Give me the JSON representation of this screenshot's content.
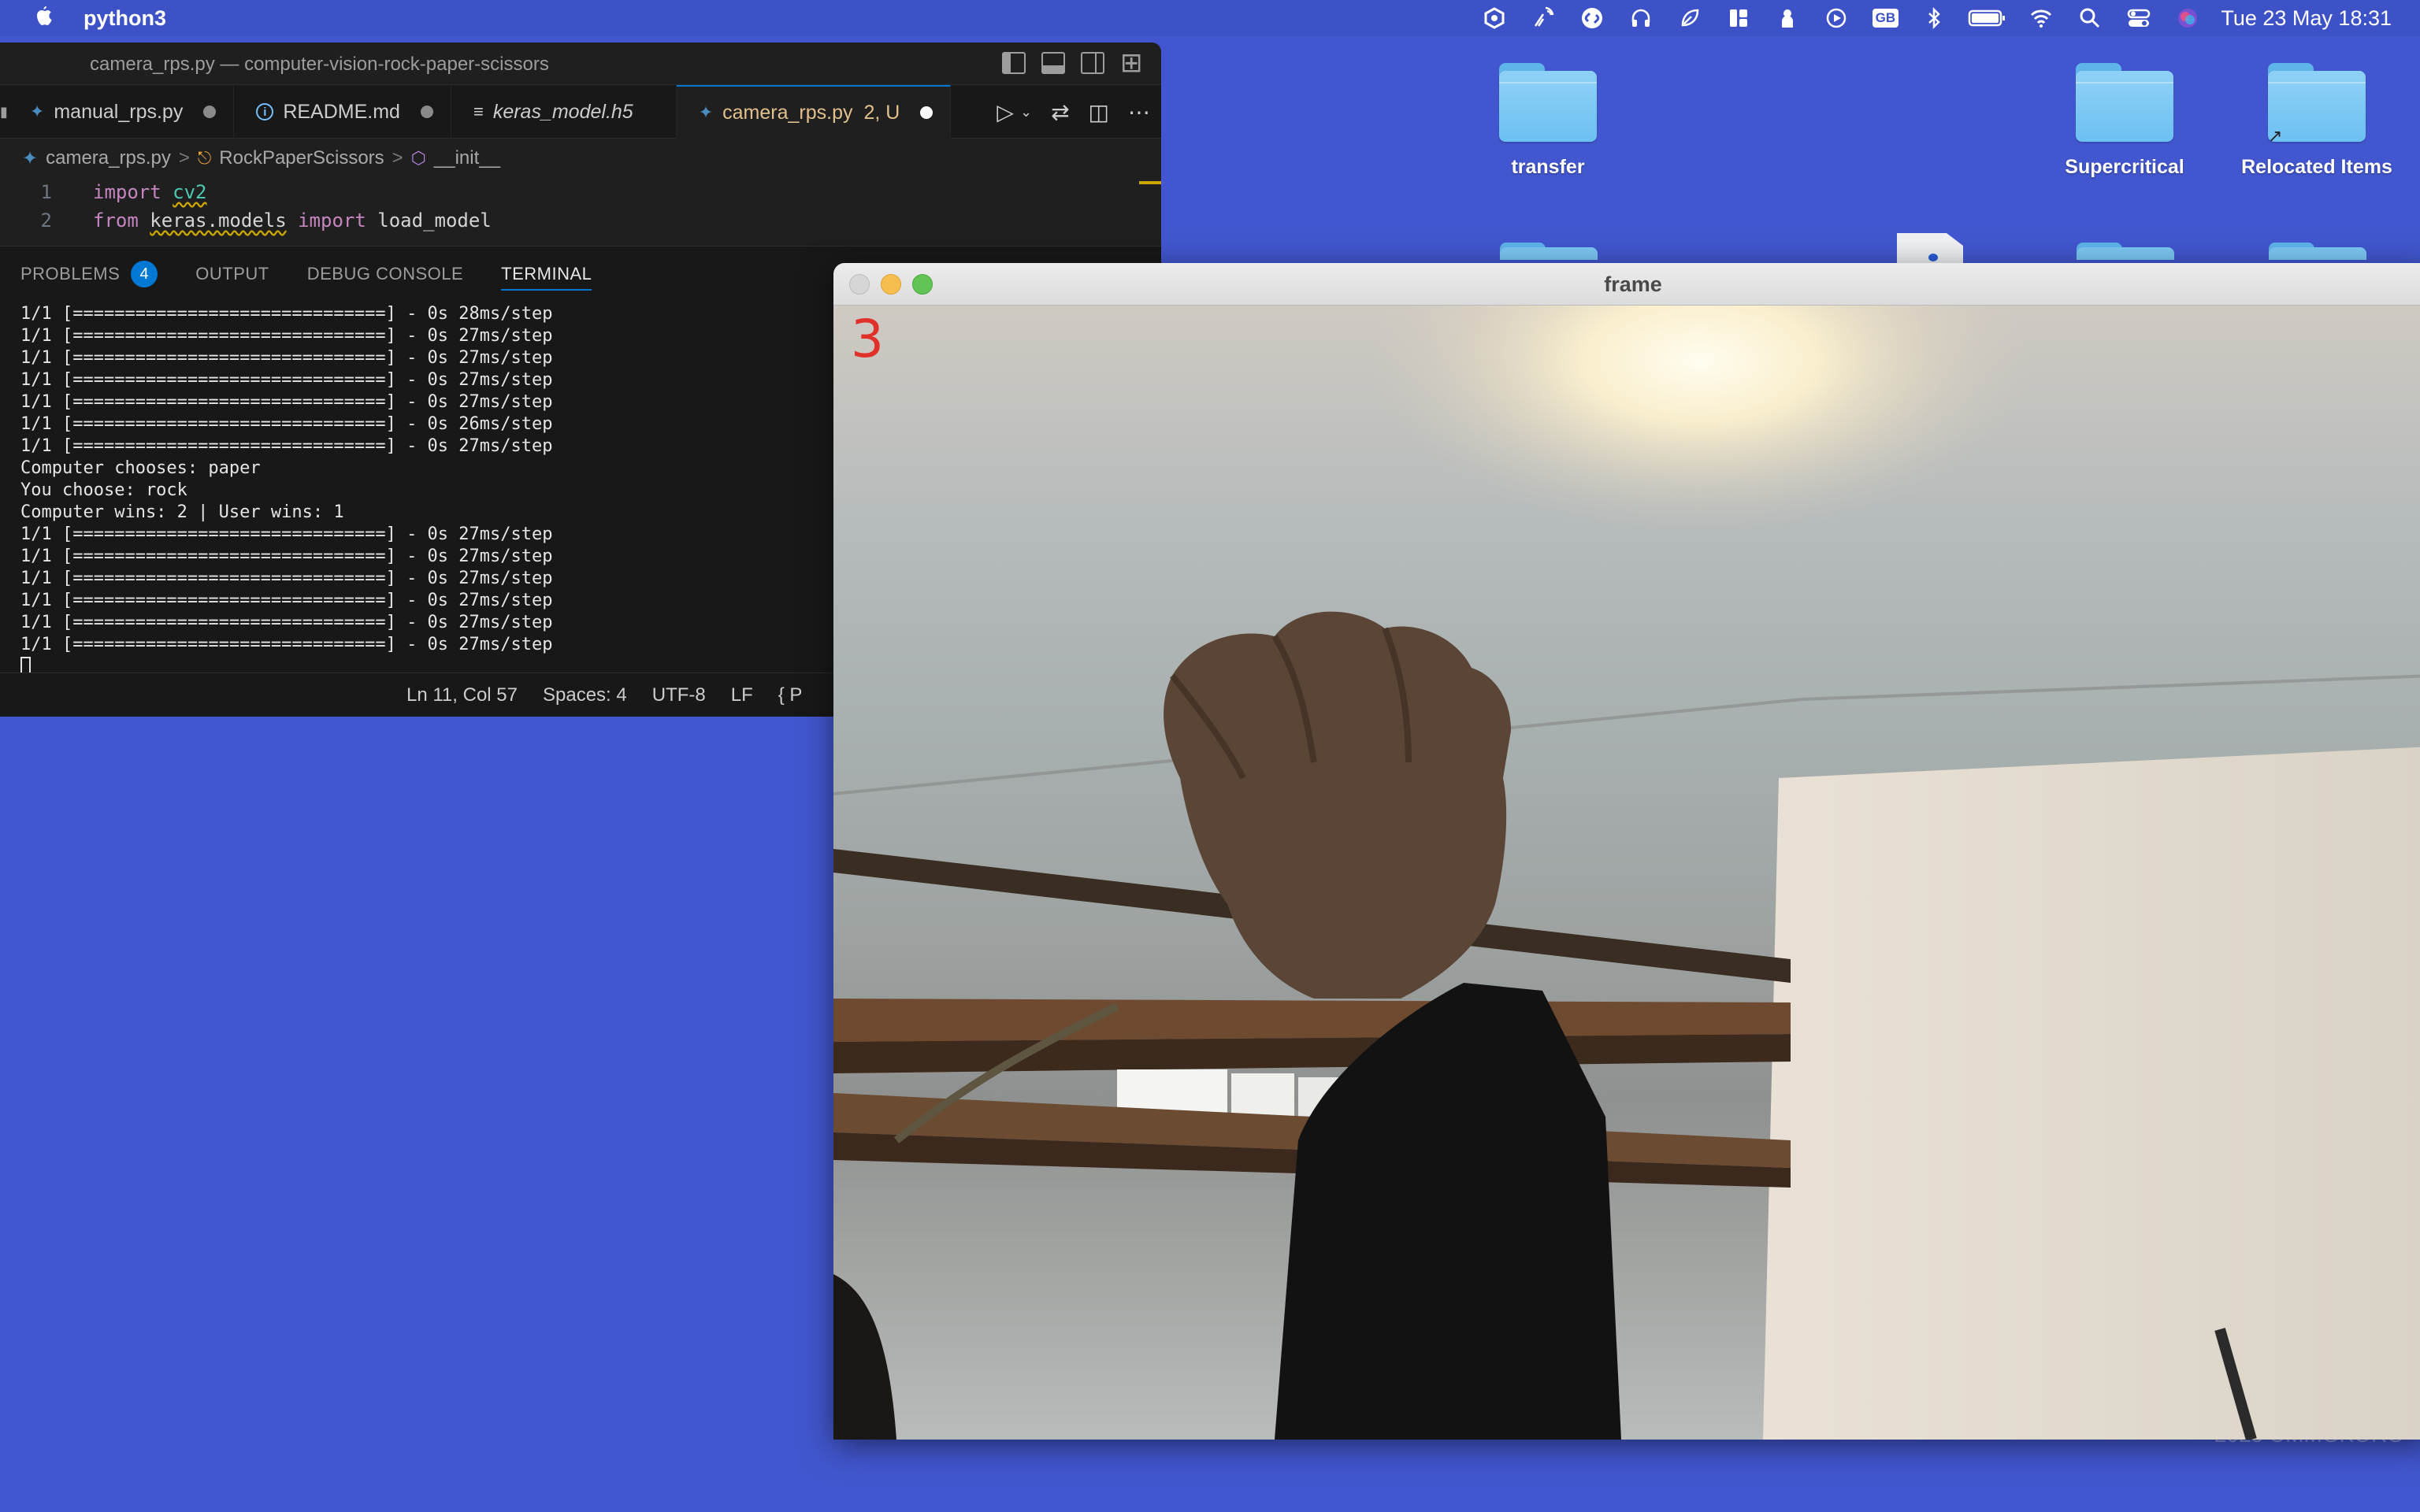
{
  "menubar": {
    "app_name": "python3",
    "clock": "Tue 23 May  18:31",
    "icons": [
      "hexagon-icon",
      "antenna-icon",
      "shazam-icon",
      "headphones-icon",
      "leaf-icon",
      "widgets-icon",
      "rocket-icon",
      "play-icon",
      "gb-input-icon",
      "bluetooth-icon",
      "battery-icon",
      "wifi-icon",
      "spotlight-icon",
      "control-center-icon",
      "siri-icon"
    ],
    "input_source": "GB"
  },
  "desktop": {
    "items": [
      {
        "label": "transfer"
      },
      {
        "label": "Supercritical"
      },
      {
        "label": "Relocated Items"
      }
    ],
    "watermark": "2025 UMMGKORO"
  },
  "vscode": {
    "window_title": "camera_rps.py — computer-vision-rock-paper-scissors",
    "tabs": [
      {
        "label": "manual_rps.py",
        "icon": "python-icon",
        "dirty": true
      },
      {
        "label": "README.md",
        "icon": "info-icon",
        "dirty": true
      },
      {
        "label": "keras_model.h5",
        "icon": "list-icon",
        "dirty": false
      },
      {
        "label": "camera_rps.py",
        "status": "2, U",
        "icon": "python-icon",
        "dirty": true,
        "active": true
      }
    ],
    "breadcrumb": [
      "camera_rps.py",
      "RockPaperScissors",
      "__init__"
    ],
    "code_lines": [
      {
        "num": "1",
        "kw1": "import",
        "name": "cv2",
        "kw2": "",
        "rest": ""
      },
      {
        "num": "2",
        "kw1": "from",
        "name": "keras.models",
        "kw2": "import",
        "rest": "load_model"
      }
    ],
    "panel_tabs": {
      "problems": "PROBLEMS",
      "problems_count": "4",
      "output": "OUTPUT",
      "debug": "DEBUG CONSOLE",
      "terminal": "TERMINAL"
    },
    "terminal_lines": [
      "1/1 [==============================] - 0s 28ms/step",
      "1/1 [==============================] - 0s 27ms/step",
      "1/1 [==============================] - 0s 27ms/step",
      "1/1 [==============================] - 0s 27ms/step",
      "1/1 [==============================] - 0s 27ms/step",
      "1/1 [==============================] - 0s 26ms/step",
      "1/1 [==============================] - 0s 27ms/step",
      "Computer chooses: paper",
      "You choose: rock",
      "Computer wins: 2 | User wins: 1",
      "1/1 [==============================] - 0s 27ms/step",
      "1/1 [==============================] - 0s 27ms/step",
      "1/1 [==============================] - 0s 27ms/step",
      "1/1 [==============================] - 0s 27ms/step",
      "1/1 [==============================] - 0s 27ms/step",
      "1/1 [==============================] - 0s 27ms/step"
    ],
    "status": {
      "position": "Ln 11, Col 57",
      "spaces": "Spaces: 4",
      "encoding": "UTF-8",
      "eol": "LF",
      "lang": "{ P"
    }
  },
  "frame_window": {
    "title": "frame",
    "countdown": "3"
  }
}
